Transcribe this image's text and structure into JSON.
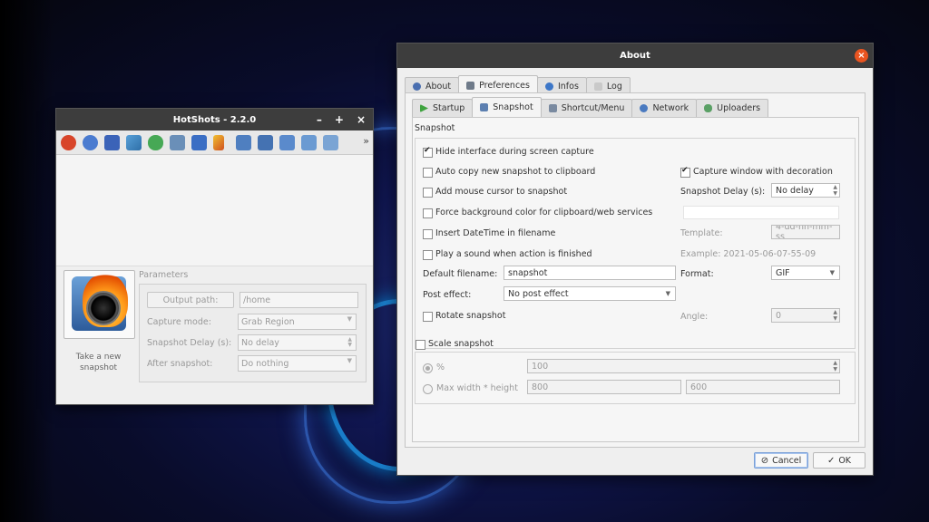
{
  "hotshots": {
    "title": "HotShots - 2.2.0",
    "controls": {
      "minimize": "–",
      "maximize": "+",
      "close": "×"
    },
    "toolbar_more": "»",
    "take_snapshot_label": "Take a new snapshot",
    "parameters": {
      "header": "Parameters",
      "output_path_button": "Output path:",
      "output_path_value": "/home",
      "capture_mode_label": "Capture mode:",
      "capture_mode_value": "Grab Region",
      "snapshot_delay_label": "Snapshot Delay (s):",
      "snapshot_delay_value": "No delay",
      "after_snapshot_label": "After snapshot:",
      "after_snapshot_value": "Do nothing"
    }
  },
  "about": {
    "title": "About",
    "close": "×",
    "tabs": [
      {
        "label": "About"
      },
      {
        "label": "Preferences",
        "active": true
      },
      {
        "label": "Infos"
      },
      {
        "label": "Log"
      }
    ],
    "subtabs": [
      {
        "label": "Startup"
      },
      {
        "label": "Snapshot",
        "active": true
      },
      {
        "label": "Shortcut/Menu"
      },
      {
        "label": "Network"
      },
      {
        "label": "Uploaders"
      }
    ],
    "snapshot": {
      "section_label": "Snapshot",
      "hide_interface": "Hide interface during screen capture",
      "auto_copy": "Auto copy new snapshot to clipboard",
      "capture_window": "Capture window with decoration",
      "add_mouse_cursor": "Add mouse cursor to snapshot",
      "snapshot_delay_label": "Snapshot Delay (s):",
      "snapshot_delay_value": "No delay",
      "force_bg_color": "Force background color for clipboard/web services",
      "insert_datetime": "Insert DateTime in filename",
      "template_label": "Template:",
      "template_value": "4-dd-hh-mm-ss",
      "play_sound": "Play a sound when action is finished",
      "example_text": "Example: 2021-05-06-07-55-09",
      "default_filename_label": "Default filename:",
      "default_filename_value": "snapshot",
      "format_label": "Format:",
      "format_value": "GIF",
      "post_effect_label": "Post effect:",
      "post_effect_value": "No post effect",
      "rotate_snapshot": "Rotate snapshot",
      "angle_label": "Angle:",
      "angle_value": "0",
      "scale_snapshot": "Scale snapshot",
      "percent_label": "%",
      "percent_value": "100",
      "max_size_label": "Max width * height",
      "max_width_value": "800",
      "max_height_value": "600"
    },
    "buttons": {
      "cancel": "Cancel",
      "ok": "OK"
    }
  },
  "colors": {
    "titlebar": "#3d3d3d",
    "close_button": "#e95420",
    "window_bg": "#efefef",
    "accent_blue": "#7aa0d8"
  }
}
